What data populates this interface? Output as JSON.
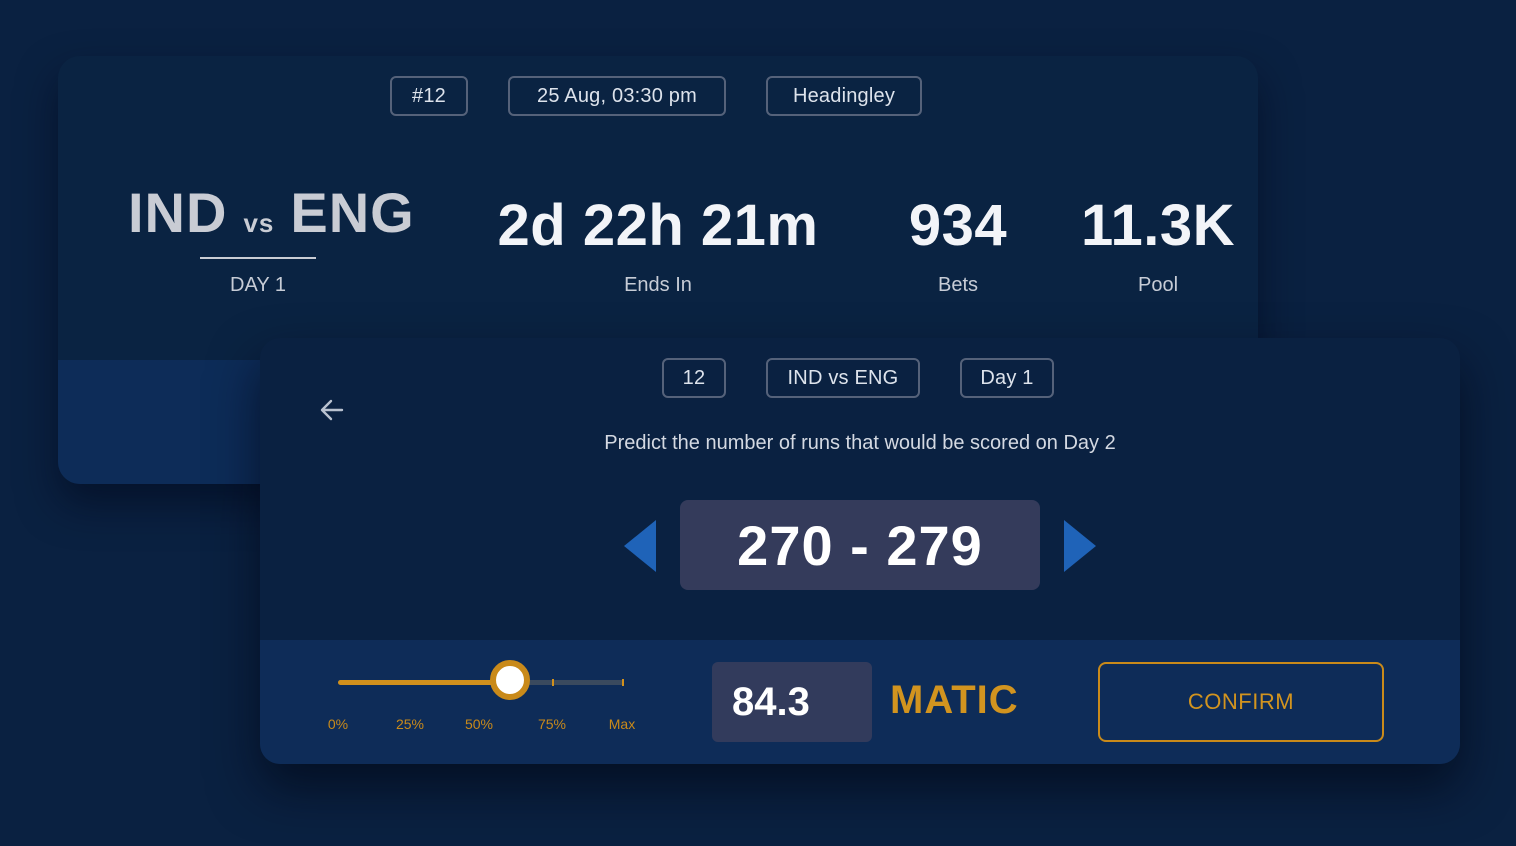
{
  "match_card": {
    "chips": [
      "#12",
      "25 Aug, 03:30 pm",
      "Headingley"
    ],
    "team_home": "IND",
    "vs": "vs",
    "team_away": "ENG",
    "day": "DAY 1",
    "stats": [
      {
        "value": "2d 22h 21m",
        "label": "Ends In"
      },
      {
        "value": "934",
        "label": "Bets"
      },
      {
        "value": "11.3K",
        "label": "Pool"
      }
    ]
  },
  "prediction": {
    "chips": [
      "12",
      "IND vs ENG",
      "Day 1"
    ],
    "prompt": "Predict the number of runs that would be scored on Day 2",
    "range": "270 - 279",
    "slider": {
      "value_fraction": 0.6,
      "labels": [
        "0%",
        "25%",
        "50%",
        "75%",
        "Max"
      ]
    },
    "amount": "84.3",
    "currency": "MATIC",
    "confirm_label": "CONFIRM"
  },
  "icons": {
    "back": "arrow-left-icon",
    "prev": "triangle-left-icon",
    "next": "triangle-right-icon"
  },
  "colors": {
    "background": "#0a2141",
    "accent": "#d2941f",
    "arrow_blue": "#1f63b8",
    "range_box": "#343b5b"
  }
}
